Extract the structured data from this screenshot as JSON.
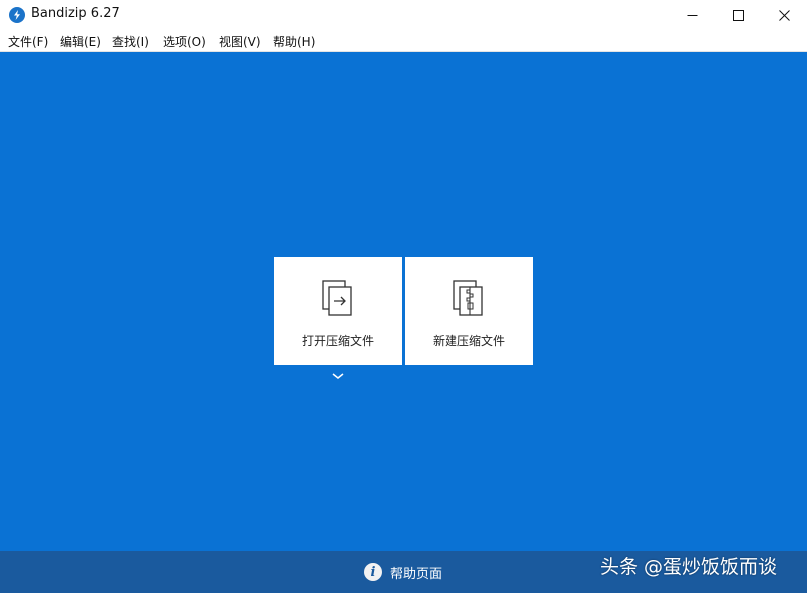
{
  "window": {
    "title": "Bandizip 6.27",
    "icons": {
      "app": "bandizip-logo-icon",
      "minimize": "minimize-icon",
      "maximize": "maximize-icon",
      "close": "close-icon"
    }
  },
  "menu": {
    "items": [
      {
        "label": "文件(F)"
      },
      {
        "label": "编辑(E)"
      },
      {
        "label": "查找(I)"
      },
      {
        "label": "选项(O)"
      },
      {
        "label": "视图(V)"
      },
      {
        "label": "帮助(H)"
      }
    ]
  },
  "main": {
    "open_archive_label": "打开压缩文件",
    "new_archive_label": "新建压缩文件",
    "icons": {
      "open": "open-archive-icon",
      "new": "new-archive-icon",
      "dropdown": "chevron-down-icon"
    }
  },
  "footer": {
    "help_label": "帮助页面",
    "help_icon": "info-icon",
    "help_icon_glyph": "i"
  },
  "watermark": {
    "text": "头条 @蛋炒饭饭而谈"
  },
  "colors": {
    "background": "#0a72d4",
    "footer": "#1a5a9e",
    "card": "#ffffff"
  }
}
